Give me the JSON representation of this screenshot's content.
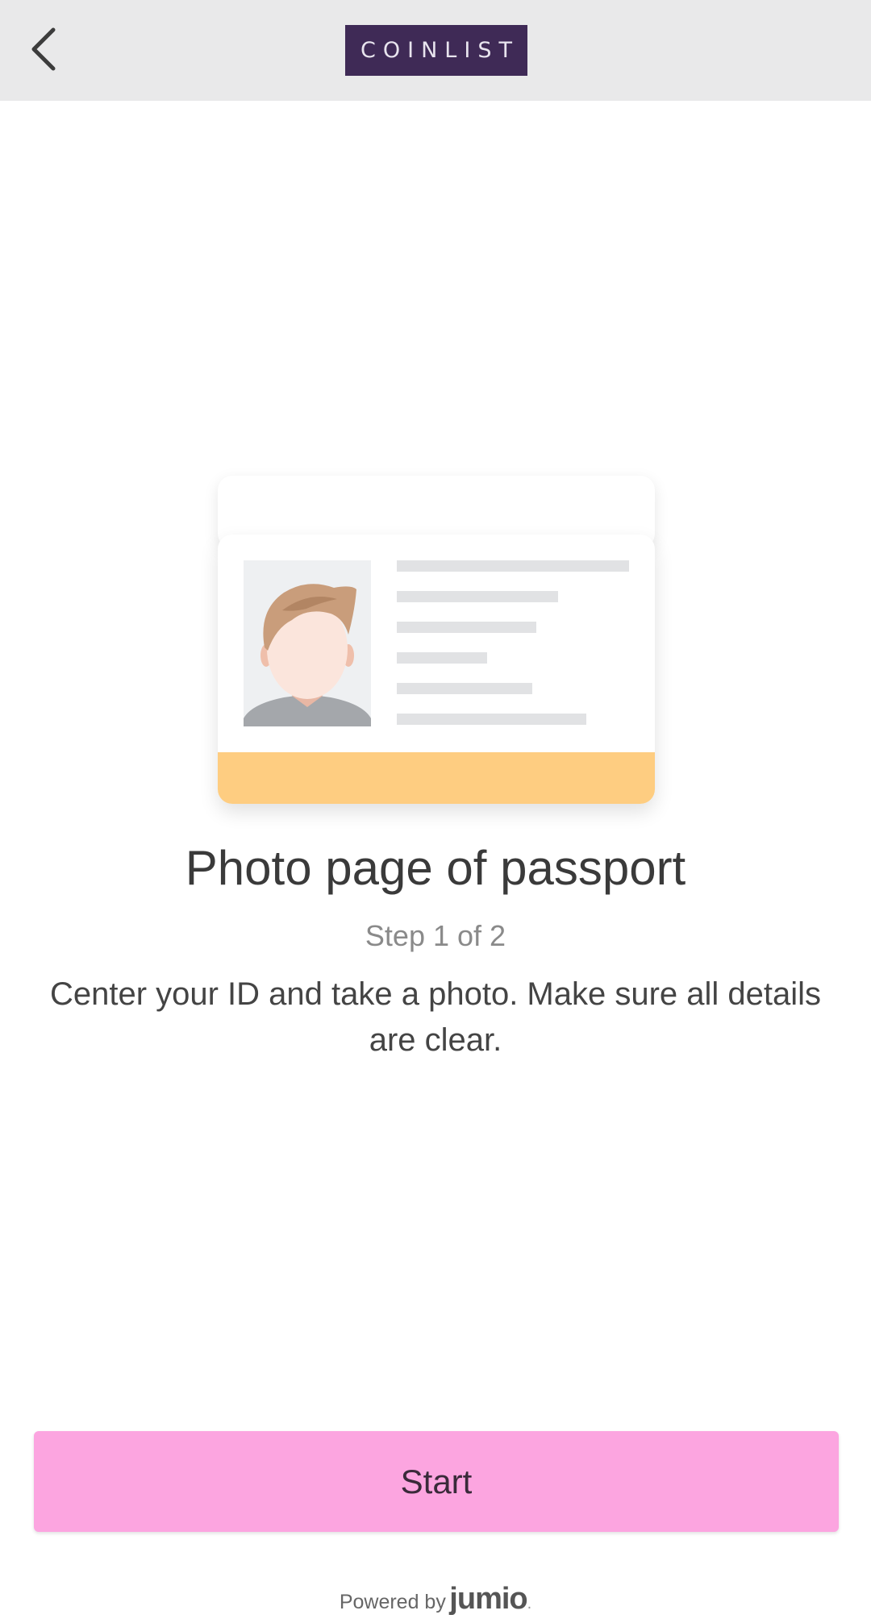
{
  "header": {
    "logo_text": "COINLIST",
    "back_icon": "chevron-left-icon",
    "background": "#e9e9ea",
    "logo_background": "#3f2a56"
  },
  "illustration": {
    "type": "passport-photo-page",
    "stripe_color": "#fecd81"
  },
  "main": {
    "title": "Photo page of passport",
    "step": "Step 1 of 2",
    "description": "Center your ID and take a photo. Make sure all details are clear."
  },
  "actions": {
    "start_label": "Start",
    "start_color": "#fca5e0"
  },
  "footer": {
    "powered_by": "Powered by",
    "brand": "jumio",
    "brand_dot": "."
  }
}
